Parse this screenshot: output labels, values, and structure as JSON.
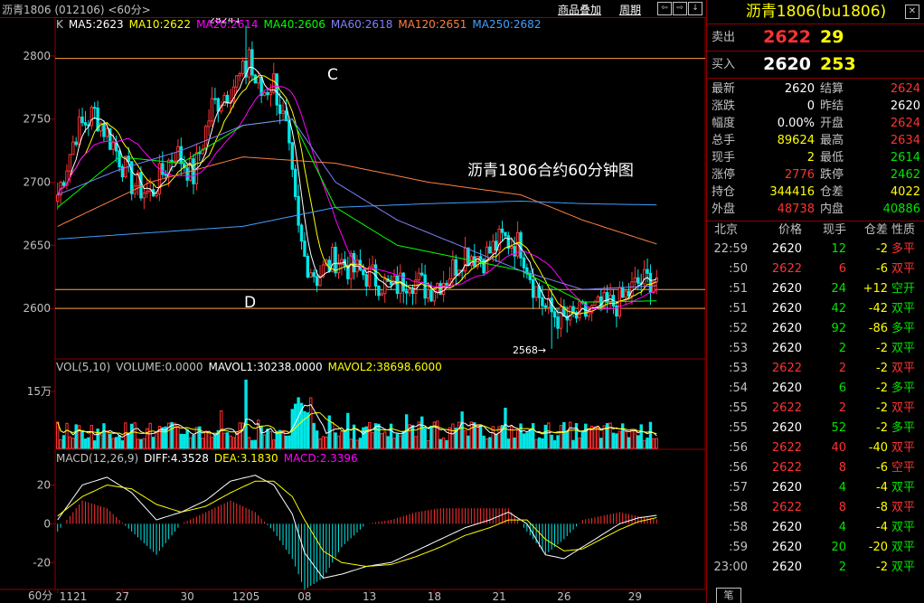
{
  "title_bar": {
    "title": "沥青1806 (012106) <60分>",
    "menu_overlay": "商品叠加",
    "menu_cycle": "周期",
    "nav_buttons": [
      "⇦",
      "⇨",
      "↓",
      "↑",
      "✕"
    ]
  },
  "overlay_title": "沥青1806合约60分钟图",
  "indicators": {
    "price": [
      {
        "text": "K",
        "color": "#c0c0c0"
      },
      {
        "text": "MA5:2623",
        "color": "#ffffff"
      },
      {
        "text": "MA10:2622",
        "color": "#ffff00"
      },
      {
        "text": "MA20:2614",
        "color": "#ff00ff"
      },
      {
        "text": "MA40:2606",
        "color": "#00ff00"
      },
      {
        "text": "MA60:2618",
        "color": "#8080ff"
      },
      {
        "text": "MA120:2651",
        "color": "#ff8040"
      },
      {
        "text": "MA250:2682",
        "color": "#40a0ff"
      }
    ],
    "volume": [
      {
        "text": "VOL(5,10)",
        "color": "#c0c0c0"
      },
      {
        "text": "VOLUME:0.0000",
        "color": "#c0c0c0"
      },
      {
        "text": "MAVOL1:30238.0000",
        "color": "#ffffff"
      },
      {
        "text": "MAVOL2:38698.6000",
        "color": "#ffff00"
      }
    ],
    "macd": [
      {
        "text": "MACD(12,26,9)",
        "color": "#c0c0c0"
      },
      {
        "text": "DIFF:4.3528",
        "color": "#ffffff"
      },
      {
        "text": "DEA:3.1830",
        "color": "#ffff00"
      },
      {
        "text": "MACD:2.3396",
        "color": "#ff00ff"
      }
    ]
  },
  "price_axis_labels": [
    "2800",
    "2750",
    "2700",
    "2650",
    "2600"
  ],
  "volume_axis_labels": [
    "15万"
  ],
  "macd_axis_labels": [
    "20",
    "0",
    "-20"
  ],
  "x_axis": {
    "period_label": "60分",
    "labels": [
      "1121",
      "27",
      "30",
      "1205",
      "08",
      "13",
      "18",
      "21",
      "26",
      "29"
    ]
  },
  "annotations": {
    "high_label": "2824",
    "low_label": "2568",
    "marker_c": "C",
    "marker_d": "D"
  },
  "quote_panel": {
    "title": "沥青1806(bu1806)",
    "sell_label": "卖出",
    "sell_price": "2622",
    "sell_vol": "29",
    "buy_label": "买入",
    "buy_price": "2620",
    "buy_vol": "253",
    "stats": [
      {
        "l1": "最新",
        "v1": "2620",
        "c1": "white",
        "l2": "结算",
        "v2": "2624",
        "c2": "red"
      },
      {
        "l1": "涨跌",
        "v1": "0",
        "c1": "white",
        "l2": "昨结",
        "v2": "2620",
        "c2": "white"
      },
      {
        "l1": "幅度",
        "v1": "0.00%",
        "c1": "white",
        "l2": "开盘",
        "v2": "2624",
        "c2": "red"
      },
      {
        "l1": "总手",
        "v1": "89624",
        "c1": "yellow",
        "l2": "最高",
        "v2": "2634",
        "c2": "red"
      },
      {
        "l1": "现手",
        "v1": "2",
        "c1": "yellow",
        "l2": "最低",
        "v2": "2614",
        "c2": "green"
      },
      {
        "l1": "涨停",
        "v1": "2776",
        "c1": "red",
        "l2": "跌停",
        "v2": "2462",
        "c2": "green"
      },
      {
        "l1": "持仓",
        "v1": "344416",
        "c1": "yellow",
        "l2": "仓差",
        "v2": "4022",
        "c2": "yellow"
      },
      {
        "l1": "外盘",
        "v1": "48738",
        "c1": "red",
        "l2": "内盘",
        "v2": "40886",
        "c2": "green"
      }
    ],
    "ticks_header": {
      "time": "北京",
      "price": "价格",
      "qty": "现手",
      "oi": "仓差",
      "nature": "性质"
    },
    "ticks": [
      {
        "time": "22:59",
        "price": "2620",
        "pc": "white",
        "qty": "12",
        "qc": "green",
        "oi": "-2",
        "oc": "yellow",
        "nature": "多平",
        "nc": "red"
      },
      {
        "time": ":50",
        "price": "2622",
        "pc": "red",
        "qty": "6",
        "qc": "red",
        "oi": "-6",
        "oc": "yellow",
        "nature": "双平",
        "nc": "red"
      },
      {
        "time": ":51",
        "price": "2620",
        "pc": "white",
        "qty": "24",
        "qc": "green",
        "oi": "+12",
        "oc": "yellow",
        "nature": "空开",
        "nc": "green"
      },
      {
        "time": ":51",
        "price": "2620",
        "pc": "white",
        "qty": "42",
        "qc": "green",
        "oi": "-42",
        "oc": "yellow",
        "nature": "双平",
        "nc": "green"
      },
      {
        "time": ":52",
        "price": "2620",
        "pc": "white",
        "qty": "92",
        "qc": "green",
        "oi": "-86",
        "oc": "yellow",
        "nature": "多平",
        "nc": "green"
      },
      {
        "time": ":53",
        "price": "2620",
        "pc": "white",
        "qty": "2",
        "qc": "green",
        "oi": "-2",
        "oc": "yellow",
        "nature": "双平",
        "nc": "green"
      },
      {
        "time": ":53",
        "price": "2622",
        "pc": "red",
        "qty": "2",
        "qc": "red",
        "oi": "-2",
        "oc": "yellow",
        "nature": "双平",
        "nc": "red"
      },
      {
        "time": ":54",
        "price": "2620",
        "pc": "white",
        "qty": "6",
        "qc": "green",
        "oi": "-2",
        "oc": "yellow",
        "nature": "多平",
        "nc": "green"
      },
      {
        "time": ":55",
        "price": "2622",
        "pc": "red",
        "qty": "2",
        "qc": "red",
        "oi": "-2",
        "oc": "yellow",
        "nature": "双平",
        "nc": "red"
      },
      {
        "time": ":55",
        "price": "2620",
        "pc": "white",
        "qty": "52",
        "qc": "green",
        "oi": "-2",
        "oc": "yellow",
        "nature": "多平",
        "nc": "green"
      },
      {
        "time": ":56",
        "price": "2622",
        "pc": "red",
        "qty": "40",
        "qc": "red",
        "oi": "-40",
        "oc": "yellow",
        "nature": "双平",
        "nc": "red"
      },
      {
        "time": ":56",
        "price": "2622",
        "pc": "red",
        "qty": "8",
        "qc": "red",
        "oi": "-6",
        "oc": "yellow",
        "nature": "空平",
        "nc": "red"
      },
      {
        "time": ":57",
        "price": "2620",
        "pc": "white",
        "qty": "4",
        "qc": "green",
        "oi": "-4",
        "oc": "yellow",
        "nature": "双平",
        "nc": "green"
      },
      {
        "time": ":58",
        "price": "2622",
        "pc": "red",
        "qty": "8",
        "qc": "red",
        "oi": "-8",
        "oc": "yellow",
        "nature": "双平",
        "nc": "red"
      },
      {
        "time": ":58",
        "price": "2620",
        "pc": "white",
        "qty": "4",
        "qc": "green",
        "oi": "-4",
        "oc": "yellow",
        "nature": "双平",
        "nc": "green"
      },
      {
        "time": ":59",
        "price": "2620",
        "pc": "white",
        "qty": "20",
        "qc": "green",
        "oi": "-20",
        "oc": "yellow",
        "nature": "双平",
        "nc": "green"
      },
      {
        "time": "23:00",
        "price": "2620",
        "pc": "white",
        "qty": "2",
        "qc": "green",
        "oi": "-2",
        "oc": "yellow",
        "nature": "双平",
        "nc": "green"
      }
    ],
    "foot_tab": "笔"
  },
  "chart_data": {
    "type": "candlestick",
    "title": "沥青1806合约60分钟图",
    "ylim": [
      2560,
      2830
    ],
    "y_ticks": [
      2600,
      2650,
      2700,
      2750,
      2800
    ],
    "horizontal_lines": [
      2798,
      2615,
      2600
    ],
    "high": 2824,
    "low": 2568,
    "close_anchors": [
      [
        0,
        2690
      ],
      [
        6,
        2740
      ],
      [
        12,
        2755
      ],
      [
        18,
        2730
      ],
      [
        24,
        2700
      ],
      [
        30,
        2690
      ],
      [
        38,
        2725
      ],
      [
        44,
        2705
      ],
      [
        50,
        2760
      ],
      [
        56,
        2775
      ],
      [
        62,
        2790
      ],
      [
        66,
        2770
      ],
      [
        70,
        2780
      ],
      [
        74,
        2740
      ],
      [
        78,
        2660
      ],
      [
        80,
        2640
      ],
      [
        84,
        2625
      ],
      [
        90,
        2640
      ],
      [
        96,
        2630
      ],
      [
        102,
        2625
      ],
      [
        108,
        2615
      ],
      [
        114,
        2625
      ],
      [
        120,
        2615
      ],
      [
        126,
        2625
      ],
      [
        132,
        2645
      ],
      [
        138,
        2640
      ],
      [
        144,
        2655
      ],
      [
        150,
        2650
      ],
      [
        154,
        2620
      ],
      [
        158,
        2600
      ],
      [
        164,
        2590
      ],
      [
        170,
        2595
      ],
      [
        176,
        2600
      ],
      [
        182,
        2605
      ],
      [
        188,
        2620
      ],
      [
        194,
        2625
      ]
    ],
    "ma_lines": {
      "MA120": [
        [
          0,
          2665
        ],
        [
          30,
          2700
        ],
        [
          60,
          2720
        ],
        [
          90,
          2715
        ],
        [
          120,
          2700
        ],
        [
          150,
          2690
        ],
        [
          170,
          2670
        ],
        [
          194,
          2651
        ]
      ],
      "MA250": [
        [
          0,
          2655
        ],
        [
          30,
          2660
        ],
        [
          60,
          2665
        ],
        [
          90,
          2680
        ],
        [
          120,
          2683
        ],
        [
          150,
          2685
        ],
        [
          170,
          2683
        ],
        [
          194,
          2682
        ]
      ],
      "MA60": [
        [
          0,
          2690
        ],
        [
          20,
          2710
        ],
        [
          40,
          2725
        ],
        [
          60,
          2745
        ],
        [
          76,
          2750
        ],
        [
          90,
          2700
        ],
        [
          110,
          2670
        ],
        [
          130,
          2650
        ],
        [
          150,
          2630
        ],
        [
          170,
          2615
        ],
        [
          194,
          2618
        ]
      ],
      "MA40": [
        [
          0,
          2680
        ],
        [
          20,
          2720
        ],
        [
          40,
          2715
        ],
        [
          60,
          2745
        ],
        [
          76,
          2750
        ],
        [
          90,
          2680
        ],
        [
          110,
          2650
        ],
        [
          130,
          2640
        ],
        [
          150,
          2630
        ],
        [
          170,
          2605
        ],
        [
          194,
          2606
        ]
      ]
    },
    "volume": {
      "ylim": [
        0,
        200000
      ],
      "tick": 150000
    },
    "macd": {
      "ylim": [
        -32,
        30
      ],
      "diff": [
        [
          0,
          2
        ],
        [
          8,
          20
        ],
        [
          16,
          24
        ],
        [
          24,
          16
        ],
        [
          32,
          2
        ],
        [
          40,
          6
        ],
        [
          48,
          12
        ],
        [
          56,
          22
        ],
        [
          64,
          25
        ],
        [
          70,
          20
        ],
        [
          76,
          5
        ],
        [
          80,
          -15
        ],
        [
          86,
          -28
        ],
        [
          92,
          -26
        ],
        [
          100,
          -22
        ],
        [
          108,
          -20
        ],
        [
          116,
          -14
        ],
        [
          124,
          -8
        ],
        [
          132,
          -2
        ],
        [
          140,
          2
        ],
        [
          146,
          6
        ],
        [
          152,
          0
        ],
        [
          158,
          -16
        ],
        [
          164,
          -18
        ],
        [
          170,
          -12
        ],
        [
          176,
          -6
        ],
        [
          182,
          0
        ],
        [
          188,
          3
        ],
        [
          194,
          4.3528
        ]
      ],
      "dea": [
        [
          0,
          4
        ],
        [
          8,
          14
        ],
        [
          16,
          20
        ],
        [
          24,
          18
        ],
        [
          32,
          10
        ],
        [
          40,
          6
        ],
        [
          48,
          9
        ],
        [
          56,
          16
        ],
        [
          64,
          22
        ],
        [
          70,
          22
        ],
        [
          76,
          14
        ],
        [
          80,
          2
        ],
        [
          86,
          -14
        ],
        [
          92,
          -20
        ],
        [
          100,
          -22
        ],
        [
          108,
          -21
        ],
        [
          116,
          -17
        ],
        [
          124,
          -12
        ],
        [
          132,
          -6
        ],
        [
          140,
          -2
        ],
        [
          146,
          2
        ],
        [
          152,
          2
        ],
        [
          158,
          -8
        ],
        [
          164,
          -14
        ],
        [
          170,
          -13
        ],
        [
          176,
          -8
        ],
        [
          182,
          -3
        ],
        [
          188,
          1
        ],
        [
          194,
          3.183
        ]
      ]
    }
  }
}
